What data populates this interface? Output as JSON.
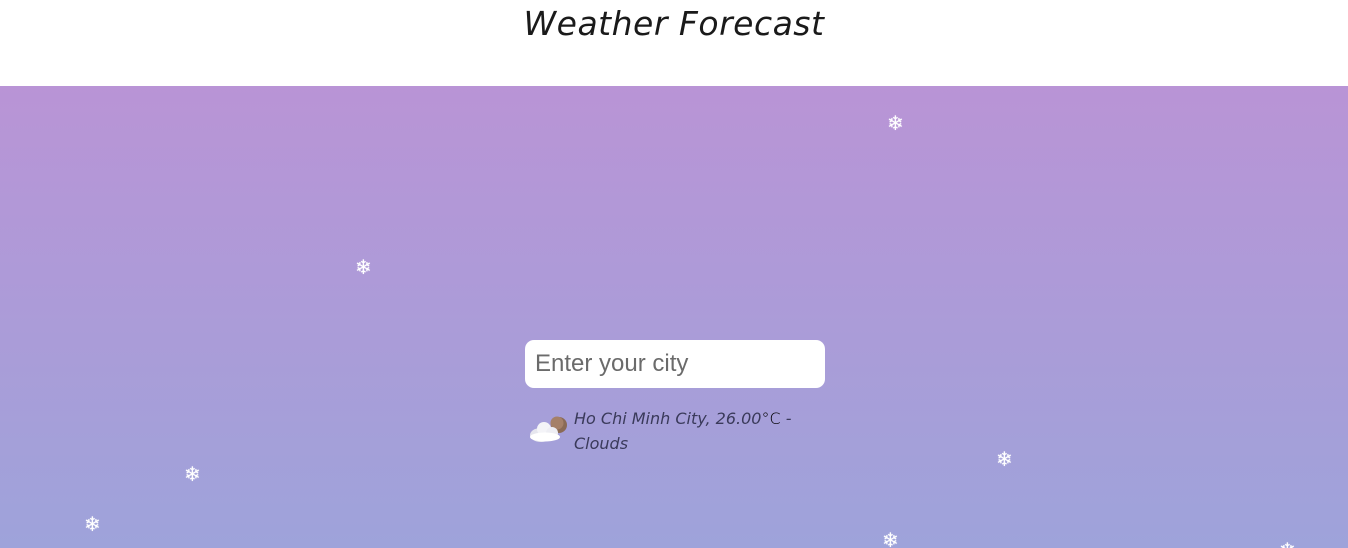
{
  "header": {
    "title": "Weather Forecast"
  },
  "search": {
    "placeholder": "Enter your city",
    "value": ""
  },
  "result": {
    "icon": "cloud-with-sun-icon",
    "city_temp": "Ho Chi Minh City, 26.00",
    "unit": "°C",
    "separator": " - ",
    "condition": "Clouds"
  },
  "decor": {
    "snowflake_glyph": "❄"
  },
  "colors": {
    "gradient_top": "#b994d6",
    "gradient_bottom": "#9ea3da",
    "text": "#3a3a5a"
  }
}
